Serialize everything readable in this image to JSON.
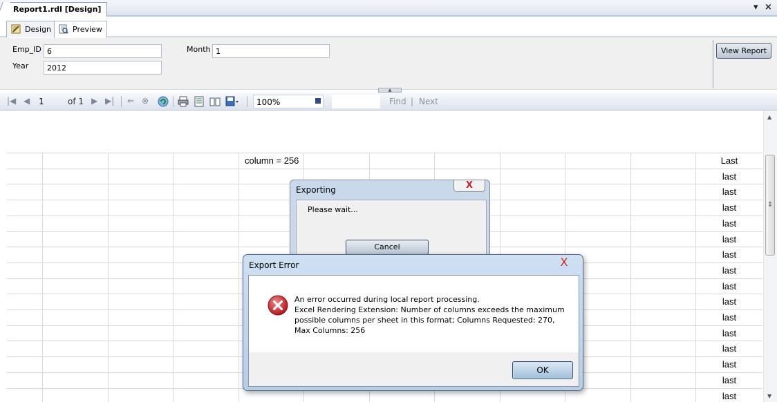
{
  "document_tab": {
    "title": "Report1.rdl [Design]"
  },
  "window_controls": {
    "dropdown": "▾",
    "close": "×"
  },
  "view_tabs": [
    {
      "label": "Design",
      "icon": "design-icon"
    },
    {
      "label": "Preview",
      "icon": "preview-icon"
    }
  ],
  "parameters": {
    "emp_id": {
      "label": "Emp_ID",
      "value": "6"
    },
    "month": {
      "label": "Month",
      "value": "1"
    },
    "year": {
      "label": "Year",
      "value": "2012"
    },
    "view_report_label": "View Report"
  },
  "toolbar": {
    "page_current": "1",
    "page_of": "of 1",
    "zoom": "100%",
    "find_label": "Find",
    "separator": "|",
    "next_label": "Next"
  },
  "report": {
    "column_header": "column = 256",
    "last_values": [
      "Last",
      "last",
      "last",
      "last",
      "last",
      "last",
      "last",
      "last",
      "last",
      "last",
      "last",
      "last",
      "last",
      "last",
      "last",
      "last"
    ]
  },
  "exporting_dialog": {
    "title": "Exporting",
    "close_glyph": "X",
    "message": "Please wait...",
    "cancel_label": "Cancel"
  },
  "error_dialog": {
    "title": "Export Error",
    "close_glyph": "X",
    "line1": "An error occurred during local report processing.",
    "line2": "Excel Rendering Extension: Number of columns exceeds the maximum",
    "line3": "possible columns per sheet in this format; Columns Requested: 270,",
    "line4": "Max Columns: 256",
    "ok_label": "OK"
  },
  "colors": {
    "error_red": "#c8262b",
    "dialog_frame": "#b7cde8",
    "toolbar_bg": "#dde3ec"
  }
}
